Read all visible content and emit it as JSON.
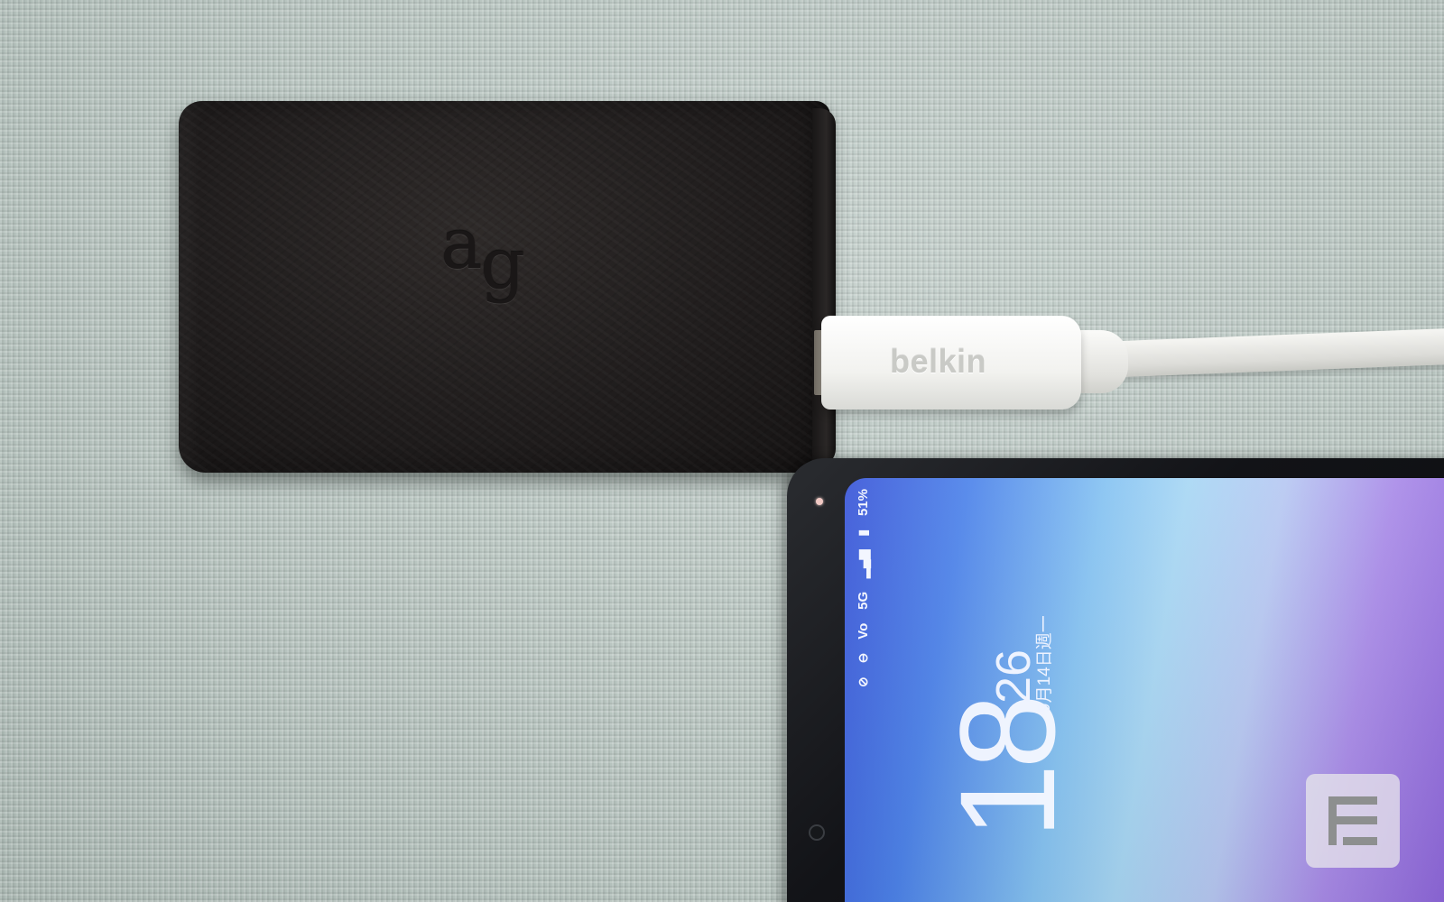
{
  "scene": {
    "description_tag": "photo",
    "fabric_color": "#b9c5c0"
  },
  "powerbank": {
    "logo_text_a": "a",
    "logo_text_g": "g",
    "color": "#201d1d"
  },
  "cable": {
    "plug_label": "belkin",
    "color": "#f2f2ef"
  },
  "phone": {
    "status": {
      "battery": "51%",
      "network": "5G",
      "carrier_icon": "Vo",
      "icons": [
        "battery-icon",
        "signal-icon",
        "volte-icon",
        "dnd-icon",
        "mute-icon"
      ]
    },
    "clock": {
      "hour": "18",
      "minute": "26",
      "date": "9月14日週一"
    }
  },
  "watermark": {
    "name": "engadget-logo-icon"
  }
}
